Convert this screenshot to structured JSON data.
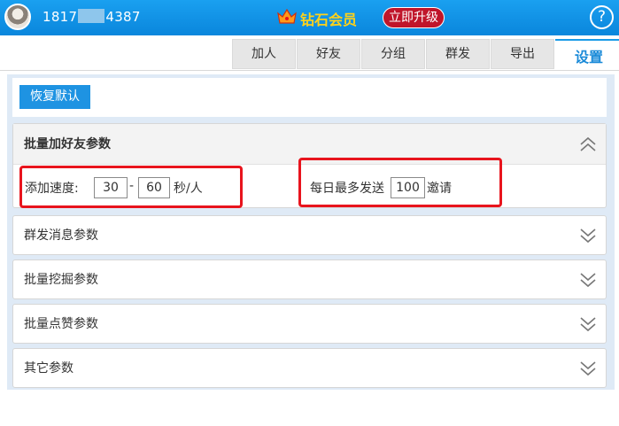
{
  "header": {
    "phone_prefix": "1817",
    "phone_suffix": "4387",
    "vip_label": "钻石会员",
    "upgrade_label": "立即升级",
    "help_label": "?"
  },
  "tabs": [
    {
      "label": "加人",
      "active": false
    },
    {
      "label": "好友",
      "active": false
    },
    {
      "label": "分组",
      "active": false
    },
    {
      "label": "群发",
      "active": false
    },
    {
      "label": "导出",
      "active": false
    },
    {
      "label": "设置",
      "active": true
    }
  ],
  "toolbar": {
    "restore_label": "恢复默认"
  },
  "sections": {
    "batch_add": {
      "title": "批量加好友参数",
      "speed_label": "添加速度:",
      "speed_min": "30",
      "speed_separator": "-",
      "speed_max": "60",
      "speed_unit": "秒/人",
      "daily_label": "每日最多发送",
      "daily_max": "100",
      "daily_unit": "邀请"
    },
    "others": [
      {
        "title": "群发消息参数"
      },
      {
        "title": "批量挖掘参数"
      },
      {
        "title": "批量点赞参数"
      },
      {
        "title": "其它参数"
      }
    ]
  },
  "colors": {
    "header_blue": "#0a86dc",
    "accent_blue": "#1e93e2",
    "upgrade_red": "#c0152a",
    "highlight_red": "#e8141d",
    "vip_gold": "#ffd21a"
  },
  "icons": [
    "crown-icon",
    "help-icon",
    "chevron-up-icon",
    "chevron-down-icon"
  ]
}
